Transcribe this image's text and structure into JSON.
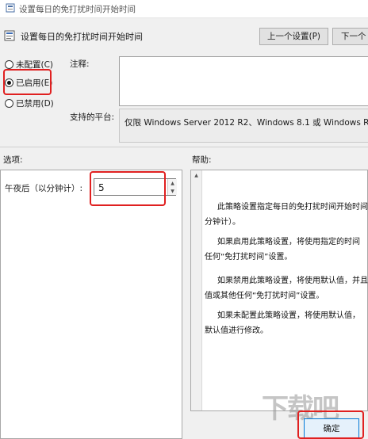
{
  "window": {
    "title": "设置每日的免打扰时间开始时间"
  },
  "header": {
    "title": "设置每日的免打扰时间开始时间",
    "prev_label": "上一个设置(P)",
    "next_label": "下一个"
  },
  "radios": [
    {
      "label": "未配置(C)",
      "checked": false
    },
    {
      "label": "已启用(E)",
      "checked": true
    },
    {
      "label": "已禁用(D)",
      "checked": false
    }
  ],
  "comment": {
    "label": "注释:"
  },
  "platform": {
    "label": "支持的平台:",
    "value": "仅限 Windows Server 2012 R2、Windows 8.1 或 Windows RT 8.1"
  },
  "options": {
    "label": "选项:",
    "field_label": "午夜后（以分钟计）:",
    "field_value": "5"
  },
  "help": {
    "label": "帮助:",
    "paragraphs": [
      [
        "此策略设置指定每日的免打扰时间开始时间",
        "分钟计）。"
      ],
      [
        "如果启用此策略设置，将使用指定的时间",
        "任何“免打扰时间”设置。"
      ],
      [
        "如果禁用此策略设置，将使用默认值，并且",
        "值或其他任何“免打扰时间”设置。"
      ],
      [
        "如果未配置此策略设置，将使用默认值，",
        "默认值进行修改。"
      ]
    ]
  },
  "footer": {
    "ok_label": "确定"
  },
  "watermark": {
    "text": "下载吧"
  },
  "colors": {
    "highlight": "#e02020",
    "ok_border": "#0078d7"
  }
}
